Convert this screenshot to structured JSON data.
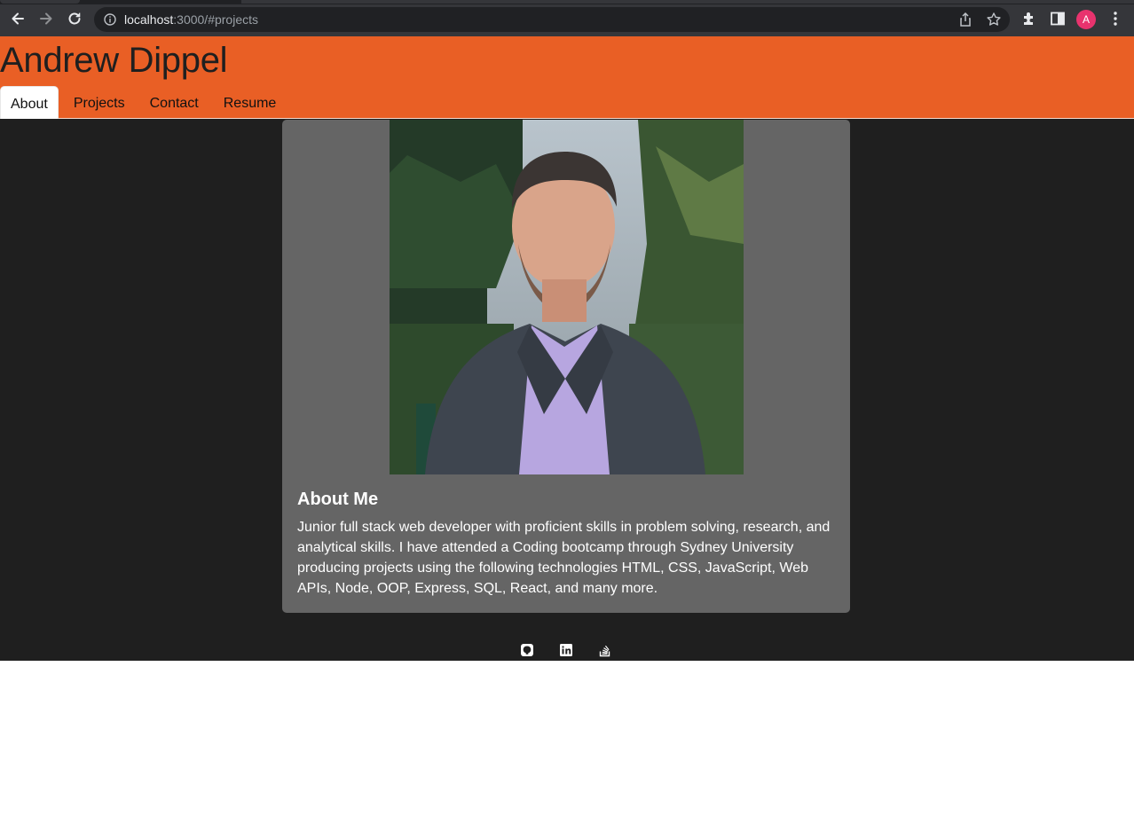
{
  "browser": {
    "url_host": "localhost",
    "url_path": ":3000/#projects",
    "profile_initial": "A",
    "icons": [
      "back-arrow-icon",
      "forward-arrow-icon",
      "reload-icon",
      "info-icon",
      "share-icon",
      "star-icon",
      "extensions-icon",
      "side-panel-icon",
      "more-menu-icon"
    ]
  },
  "header": {
    "title": "Andrew Dippel",
    "nav": [
      {
        "label": "About",
        "active": true
      },
      {
        "label": "Projects",
        "active": false
      },
      {
        "label": "Contact",
        "active": false
      },
      {
        "label": "Resume",
        "active": false
      }
    ]
  },
  "about": {
    "heading": "About Me",
    "body": "Junior full stack web developer with proficient skills in problem solving, research, and analytical skills. I have attended a Coding bootcamp through Sydney University producing projects using the following technologies HTML, CSS, JavaScript, Web APIs, Node, OOP, Express, SQL, React, and many more."
  },
  "footer": {
    "icons": [
      "github-icon",
      "linkedin-icon",
      "stackoverflow-icon"
    ]
  },
  "colors": {
    "header_bg": "#e95f25",
    "dark_bg": "#1f1f1f",
    "card_bg": "#656565",
    "chrome_bg": "#35363a"
  }
}
